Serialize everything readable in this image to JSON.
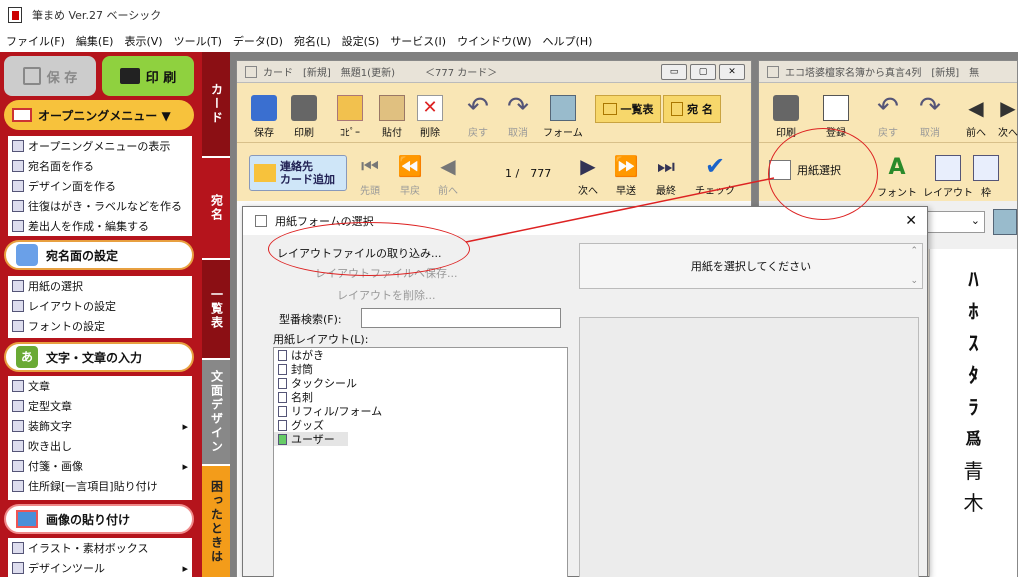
{
  "app": {
    "title": "筆まめ Ver.27 ベーシック"
  },
  "menu": [
    "ファイル(F)",
    "編集(E)",
    "表示(V)",
    "ツール(T)",
    "データ(D)",
    "宛名(L)",
    "設定(S)",
    "サービス(I)",
    "ウインドウ(W)",
    "ヘルプ(H)"
  ],
  "left": {
    "save": "保 存",
    "print": "印 刷",
    "opening": "オープニングメニュー ▼",
    "opening_items": [
      "オープニングメニューの表示",
      "宛名面を作る",
      "デザイン面を作る",
      "往復はがき・ラベルなどを作る",
      "差出人を作成・編集する"
    ],
    "address_hd": "宛名面の設定",
    "address_items": [
      "用紙の選択",
      "レイアウトの設定",
      "フォントの設定"
    ],
    "text_hd": "文字・文章の入力",
    "text_items": [
      "文章",
      "定型文章",
      "装飾文字",
      "吹き出し",
      "付箋・画像",
      "住所録[一言項目]貼り付け"
    ],
    "image_hd": "画像の貼り付け",
    "image_items": [
      "イラスト・素材ボックス",
      "デザインツール"
    ]
  },
  "tabs": {
    "card": "カード",
    "address": "宛名",
    "list": "一覧表",
    "design": "文面デザイン",
    "help": "困ったときは"
  },
  "card_window": {
    "title": "カード　[新規]　無題1(更新)　　　＜777 カード＞",
    "toolbar": [
      "保存",
      "印刷",
      "ｺﾋﾟｰ",
      "貼付",
      "削除",
      "戻す",
      "取消",
      "フォーム"
    ],
    "list_btn": "一覧表",
    "addr_btn": "宛 名",
    "add_contact": "連絡先\nカード追加",
    "nav": [
      "先頭",
      "早戻",
      "前へ"
    ],
    "count": "1 /　777",
    "nav2": [
      "次へ",
      "早送",
      "最終",
      "チェック"
    ]
  },
  "right_window": {
    "title": "エコ塔婆檀家名簿から真言4列　[新規]　無",
    "toolbar": [
      "印刷",
      "登録",
      "戻す",
      "取消",
      "前へ",
      "次へ"
    ],
    "paper_select": "用紙選択",
    "font": "フォント",
    "layout": "レイアウト",
    "frame": "枠",
    "vertical_text": [
      "ﾊ",
      "ﾎ",
      "ｽ",
      "ﾀ",
      "ﾗ",
      "爲",
      "青",
      "木"
    ]
  },
  "dialog": {
    "title": "用紙フォームの選択",
    "import": "レイアウトファイルの取り込み...",
    "save": "レイアウトファイルへ保存...",
    "delete": "レイアウトを削除...",
    "search_label": "型番検索(F):",
    "search_value": "",
    "layout_label": "用紙レイアウト(L):",
    "layouts": [
      "はがき",
      "封筒",
      "タックシール",
      "名刺",
      "リフィル/フォーム",
      "グッズ",
      "ユーザー"
    ],
    "message": "用紙を選択してください",
    "close": "✕"
  }
}
